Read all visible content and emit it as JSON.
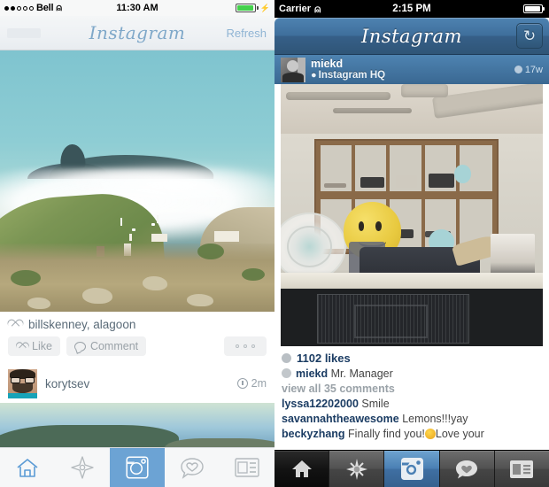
{
  "left_phone": {
    "status_bar": {
      "carrier": "Bell",
      "signal_dots_filled": 2,
      "signal_dots_total": 5,
      "wifi_icon": "wifi-icon",
      "time": "11:30 AM",
      "battery_level_pct": 95,
      "battery_state": "charging",
      "battery_icon": "battery-charging-icon"
    },
    "nav_bar": {
      "title": "Instagram",
      "refresh_label": "Refresh"
    },
    "post": {
      "photo_alt": "foggy coastal bay with green hills and boats",
      "likers": "billskenney, alagoon",
      "like_button": "Like",
      "comment_button": "Comment",
      "more_button": "•••"
    },
    "next_post": {
      "username": "korytsev",
      "timestamp": "2m",
      "avatar": "man-with-glasses-avatar"
    },
    "tab_bar": {
      "items": [
        {
          "name": "home",
          "icon": "home-icon",
          "active": true
        },
        {
          "name": "explore",
          "icon": "compass-star-icon",
          "active": false
        },
        {
          "name": "camera",
          "icon": "camera-icon",
          "active": false,
          "highlighted": true
        },
        {
          "name": "activity",
          "icon": "heart-speech-bubble-icon",
          "active": false
        },
        {
          "name": "profile",
          "icon": "profile-card-icon",
          "active": false
        }
      ]
    }
  },
  "right_phone": {
    "status_bar": {
      "carrier": "Carrier",
      "wifi_icon": "wifi-icon",
      "time": "2:15 PM",
      "battery_level_pct": 92,
      "battery_icon": "battery-icon"
    },
    "nav_bar": {
      "title": "Instagram",
      "refresh_icon": "refresh-circular-arrow-icon"
    },
    "post": {
      "username": "miekd",
      "location": "Instagram HQ",
      "location_icon": "map-pin-icon",
      "timestamp": "17w",
      "avatar": "black-and-white-portrait-avatar",
      "photo_alt": "person with yellow smiley balloon head at office desk with cameras on shelf",
      "likes": "1102 likes",
      "caption_user": "miekd",
      "caption_text": "Mr. Manager",
      "view_all": "view all 35 comments",
      "comments": [
        {
          "user": "lyssa12202000",
          "text": "Smile"
        },
        {
          "user": "savannahtheawesome",
          "text": "Lemons!!!yay"
        },
        {
          "user": "beckyzhang",
          "text_before": "Finally find you!",
          "emoji": "smiley-emoji",
          "text_after": "Love your"
        }
      ]
    },
    "tab_bar": {
      "items": [
        {
          "name": "home",
          "icon": "home-icon",
          "active": true
        },
        {
          "name": "explore",
          "icon": "compass-star-icon",
          "active": false
        },
        {
          "name": "camera",
          "icon": "camera-icon",
          "active": false,
          "highlighted": true
        },
        {
          "name": "activity",
          "icon": "heart-speech-bubble-icon",
          "active": false
        },
        {
          "name": "profile",
          "icon": "profile-card-icon",
          "active": false
        }
      ]
    }
  },
  "colors": {
    "ios7_blue": "#8fb4d4",
    "ios6_navbar_blue": "#3f6f9c",
    "camera_tab_blue": "#4b80b4",
    "link_blue": "#1b3c63",
    "gray_text": "#9aa2a8"
  }
}
